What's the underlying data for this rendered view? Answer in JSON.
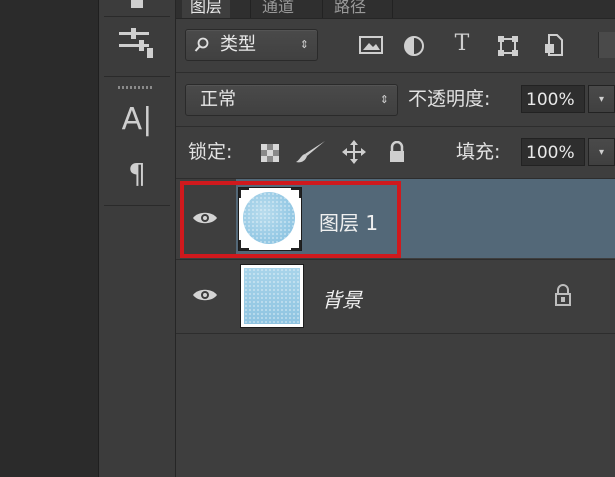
{
  "panel": {
    "tabs": [
      {
        "label": "图层",
        "active": true
      },
      {
        "label": "通道",
        "active": false
      },
      {
        "label": "路径",
        "active": false
      }
    ]
  },
  "filter": {
    "kind_icon": "search-icon",
    "kind_label": "类型",
    "kind_arrow": "⇕",
    "icons": [
      "image-filter-icon",
      "adjustment-filter-icon",
      "type-filter-icon",
      "shape-filter-icon",
      "smart-object-filter-icon"
    ]
  },
  "blend": {
    "mode": "正常",
    "opacity_label": "不透明度:",
    "opacity_value": "100%"
  },
  "lock": {
    "label": "锁定:",
    "icons": [
      "lock-transparent-icon",
      "lock-image-icon",
      "lock-position-icon",
      "lock-all-icon"
    ],
    "fill_label": "填充:",
    "fill_value": "100%"
  },
  "layers": [
    {
      "name": "图层 1",
      "visible": true,
      "selected": true,
      "highlighted": true,
      "locked": false,
      "thumbnail": "circle"
    },
    {
      "name": "背景",
      "visible": true,
      "selected": false,
      "highlighted": false,
      "locked": true,
      "thumbnail": "fill"
    }
  ],
  "tools": [
    "brush-settings-icon",
    "character-icon",
    "paragraph-icon"
  ],
  "colors": {
    "selected_layer": "#536878",
    "highlight_box": "#d0191d",
    "panel_bg": "#3e3e3e"
  }
}
